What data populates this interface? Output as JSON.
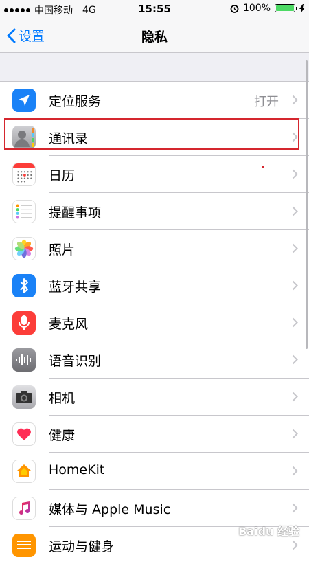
{
  "status_bar": {
    "carrier": "中国移动",
    "network": "4G",
    "time": "15:55",
    "battery": "100%",
    "battery_fill": 1.0
  },
  "nav": {
    "back_label": "设置",
    "title": "隐私"
  },
  "rows": [
    {
      "label": "定位服务",
      "value": "打开",
      "icon": "location-arrow-icon"
    },
    {
      "label": "通讯录",
      "value": "",
      "icon": "contacts-icon"
    },
    {
      "label": "日历",
      "value": "",
      "icon": "calendar-icon"
    },
    {
      "label": "提醒事项",
      "value": "",
      "icon": "reminders-icon"
    },
    {
      "label": "照片",
      "value": "",
      "icon": "photos-icon"
    },
    {
      "label": "蓝牙共享",
      "value": "",
      "icon": "bluetooth-icon"
    },
    {
      "label": "麦克风",
      "value": "",
      "icon": "microphone-icon"
    },
    {
      "label": "语音识别",
      "value": "",
      "icon": "speech-recognition-icon"
    },
    {
      "label": "相机",
      "value": "",
      "icon": "camera-icon"
    },
    {
      "label": "健康",
      "value": "",
      "icon": "health-heart-icon"
    },
    {
      "label": "HomeKit",
      "value": "",
      "icon": "homekit-icon"
    },
    {
      "label": "媒体与 Apple Music",
      "value": "",
      "icon": "music-icon"
    },
    {
      "label": "运动与健身",
      "value": "",
      "icon": "motion-fitness-icon"
    }
  ],
  "colors": {
    "accent": "#007aff",
    "highlight": "#d5262e",
    "background": "#efeff4"
  },
  "watermark": "Baidu 经验"
}
